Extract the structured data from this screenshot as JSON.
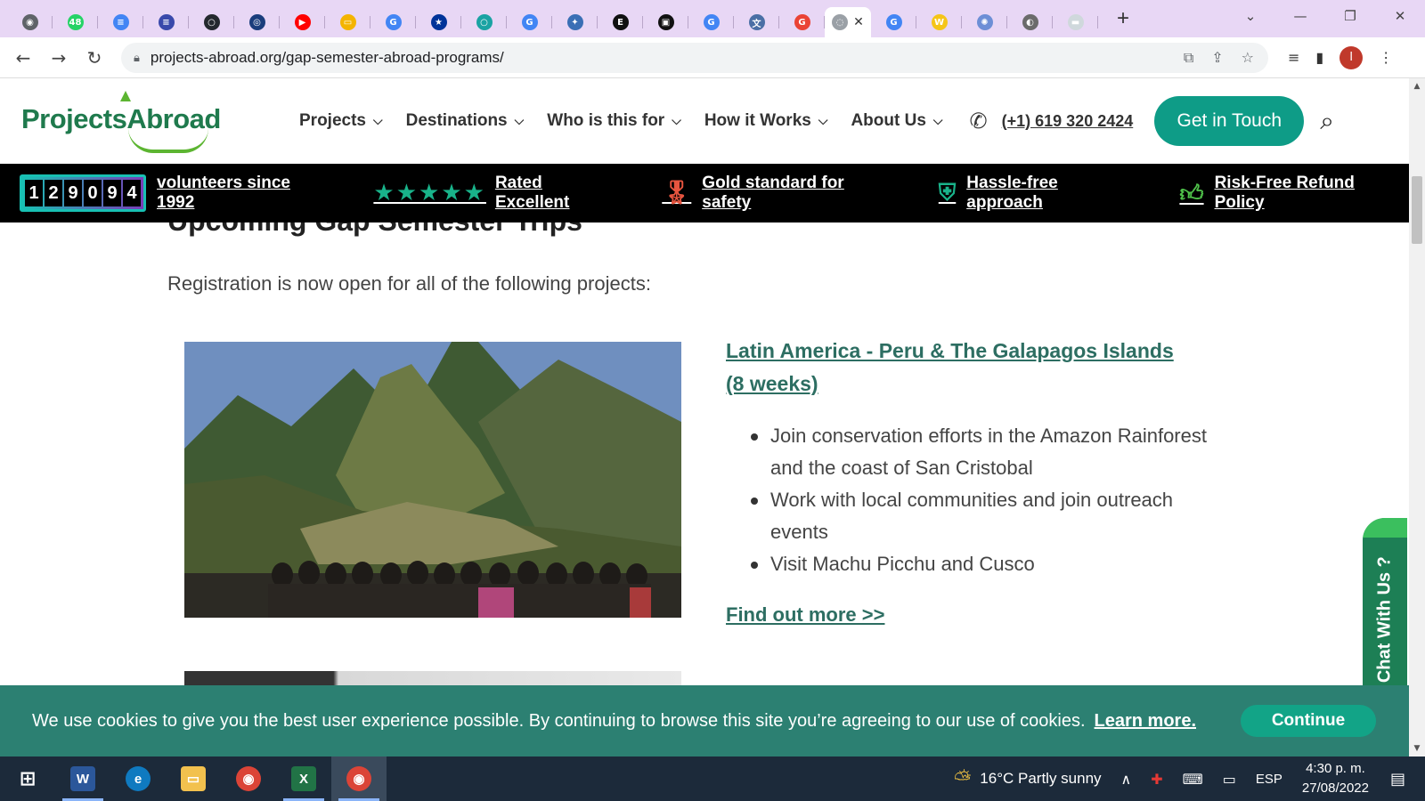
{
  "browser": {
    "tabs": [
      {
        "icon": "chrome-icon",
        "color": "#5f6368",
        "glyph": "◉"
      },
      {
        "icon": "whatsapp-badge-icon",
        "color": "#25d366",
        "glyph": "48"
      },
      {
        "icon": "docs-icon",
        "color": "#4285f4",
        "glyph": "≡"
      },
      {
        "icon": "list-icon",
        "color": "#3949ab",
        "glyph": "≡"
      },
      {
        "icon": "github-icon",
        "color": "#24292e",
        "glyph": "○"
      },
      {
        "icon": "target-icon",
        "color": "#1a3d7c",
        "glyph": "◎"
      },
      {
        "icon": "youtube-icon",
        "color": "#ff0000",
        "glyph": "▶"
      },
      {
        "icon": "slides-icon",
        "color": "#f4b400",
        "glyph": "▭"
      },
      {
        "icon": "google-icon",
        "color": "#4285f4",
        "glyph": "G"
      },
      {
        "icon": "eu-flag-icon",
        "color": "#003399",
        "glyph": "★"
      },
      {
        "icon": "circle-icon",
        "color": "#1aa3a3",
        "glyph": "○"
      },
      {
        "icon": "google-icon",
        "color": "#4285f4",
        "glyph": "G"
      },
      {
        "icon": "puzzle-icon",
        "color": "#3a6fb5",
        "glyph": "✦"
      },
      {
        "icon": "letter-e-icon",
        "color": "#111111",
        "glyph": "E"
      },
      {
        "icon": "bracket-icon",
        "color": "#111111",
        "glyph": "▣"
      },
      {
        "icon": "google-icon",
        "color": "#4285f4",
        "glyph": "G"
      },
      {
        "icon": "translate-icon",
        "color": "#4a6fa5",
        "glyph": "文"
      },
      {
        "icon": "google-color-icon",
        "color": "#ea4335",
        "glyph": "G"
      },
      {
        "icon": "loading-icon",
        "color": "#9aa0a6",
        "glyph": "◌"
      },
      {
        "icon": "google-icon",
        "color": "#4285f4",
        "glyph": "G"
      },
      {
        "icon": "w-badge-icon",
        "color": "#f5c518",
        "glyph": "W"
      },
      {
        "icon": "globe-icon",
        "color": "#6d8fd6",
        "glyph": "✺"
      },
      {
        "icon": "globe-gray-icon",
        "color": "#6b6b6b",
        "glyph": "◐"
      },
      {
        "icon": "page-icon",
        "color": "#cfd8dc",
        "glyph": "▬"
      }
    ],
    "url": "projects-abroad.org/gap-semester-abroad-programs/",
    "profile_initial": "I"
  },
  "site": {
    "logo_text": "ProjectsAbroad",
    "nav": [
      {
        "label": "Projects"
      },
      {
        "label": "Destinations"
      },
      {
        "label": "Who is this for"
      },
      {
        "label": "How it Works"
      },
      {
        "label": "About Us"
      }
    ],
    "phone": "(+1) 619 320 2424",
    "cta_label": "Get in Touch",
    "accent_color": "#0e9c87"
  },
  "trust_bar": {
    "counter_digits": [
      "1",
      "2",
      "9",
      "0",
      "9",
      "4"
    ],
    "volunteers_label": "volunteers since 1992",
    "rating_stars": "★★★★★",
    "rated_label": "Rated Excellent",
    "safety_label": "Gold standard for safety",
    "hassle_label": "Hassle-free approach",
    "refund_label": "Risk-Free Refund Policy"
  },
  "main": {
    "section_title": "Upcoming Gap Semester Trips",
    "intro": "Registration is now open for all of the following projects:",
    "trip": {
      "title": "Latin America - Peru & The Galapagos Islands (8 weeks)",
      "bullets": [
        "Join conservation efforts in the Amazon Rainforest and the coast of San Cristobal",
        "Work with local communities and join outreach events",
        "Visit Machu Picchu and Cusco"
      ],
      "link": "Find out more >>"
    }
  },
  "chat": {
    "label": "? Chat With Us ?"
  },
  "cookie": {
    "text": "We use cookies to give you the best user experience possible. By continuing to browse this site you’re agreeing to our use of cookies.",
    "learn_more": "Learn more.",
    "continue": "Continue"
  },
  "taskbar": {
    "weather": "16°C  Partly sunny",
    "language": "ESP",
    "time": "4:30 p. m.",
    "date": "27/08/2022"
  }
}
